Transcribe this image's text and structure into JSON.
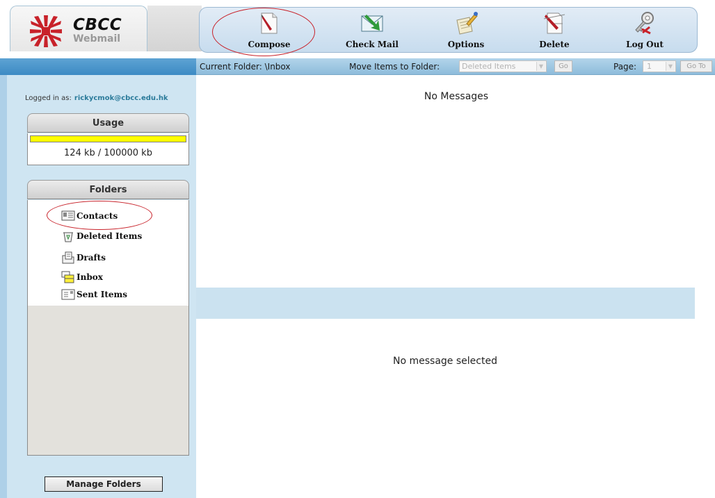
{
  "brand": {
    "name": "CBCC",
    "product": "Webmail",
    "accent_color": "#c8222a"
  },
  "toolbar": {
    "buttons": [
      {
        "label": "Compose",
        "icon": "compose-icon"
      },
      {
        "label": "Check Mail",
        "icon": "check-mail-icon"
      },
      {
        "label": "Options",
        "icon": "options-icon"
      },
      {
        "label": "Delete",
        "icon": "delete-icon"
      },
      {
        "label": "Log Out",
        "icon": "logout-icon"
      }
    ]
  },
  "infobar": {
    "current_folder": "Current Folder: \\Inbox",
    "move_label": "Move Items to Folder:",
    "move_selected": "Deleted Items",
    "go_label": "Go",
    "page_label": "Page:",
    "page_selected": "1",
    "goto_label": "Go To"
  },
  "sidebar": {
    "logged_in_label": "Logged in as:",
    "user_email": "rickycmok@cbcc.edu.hk",
    "usage": {
      "title": "Usage",
      "text": "124 kb / 100000 kb",
      "fill_fraction": 1.0,
      "bar_color": "#ffff00"
    },
    "folders": {
      "title": "Folders",
      "items": [
        {
          "label": "Contacts",
          "icon": "contacts-card-icon"
        },
        {
          "label": "Deleted Items",
          "icon": "recycle-bin-icon"
        },
        {
          "label": "Drafts",
          "icon": "drafts-icon"
        },
        {
          "label": "Inbox",
          "icon": "inbox-icon"
        },
        {
          "label": "Sent Items",
          "icon": "sent-items-icon"
        }
      ]
    },
    "manage_folders_label": "Manage Folders"
  },
  "main": {
    "list_empty_text": "No Messages",
    "preview_empty_text": "No message selected"
  }
}
